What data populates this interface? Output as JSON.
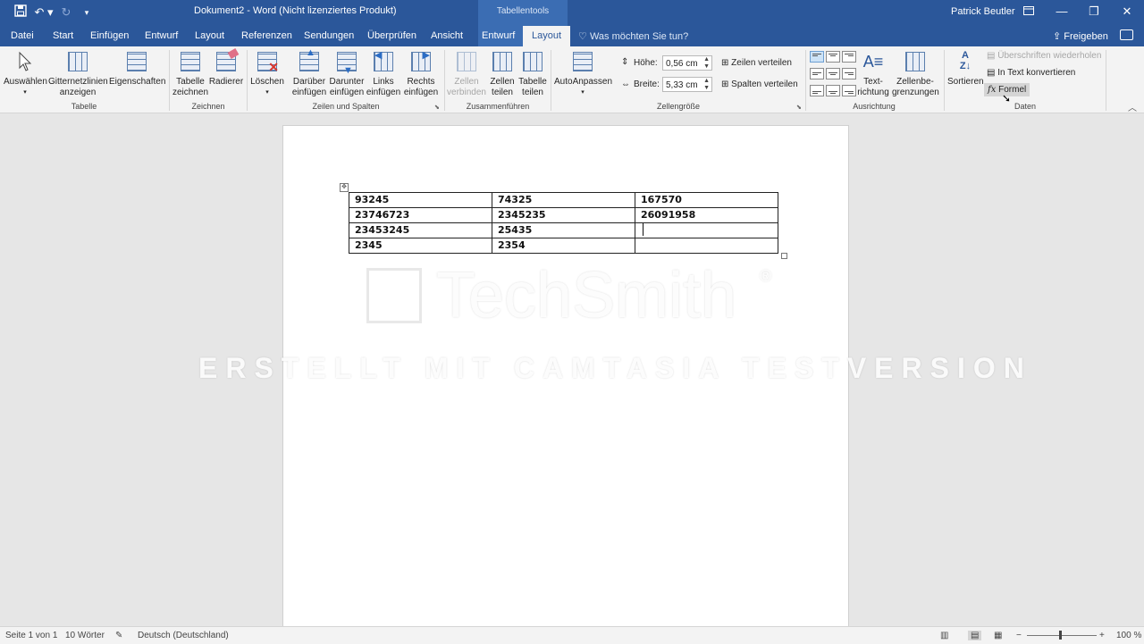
{
  "titlebar": {
    "title": "Dokument2 - Word (Nicht lizenziertes Produkt)",
    "context_tools": "Tabellentools",
    "user": "Patrick Beutler",
    "save_icon": "save-icon",
    "undo_icon": "undo-icon",
    "redo_icon": "redo-icon",
    "customize_icon": "customize-quick-access-icon"
  },
  "tabs": {
    "file": "Datei",
    "home": "Start",
    "insert": "Einfügen",
    "design": "Entwurf",
    "layout": "Layout",
    "references": "Referenzen",
    "mailings": "Sendungen",
    "review": "Überprüfen",
    "view": "Ansicht",
    "table_design": "Entwurf",
    "table_layout": "Layout",
    "tell_me": "Was möchten Sie tun?",
    "share": "Freigeben"
  },
  "ribbon": {
    "tabelle": {
      "label": "Tabelle",
      "select": "Auswählen",
      "gridlines_1": "Gitternetzlinien",
      "gridlines_2": "anzeigen",
      "properties": "Eigenschaften"
    },
    "zeichnen": {
      "label": "Zeichnen",
      "draw_1": "Tabelle",
      "draw_2": "zeichnen",
      "eraser": "Radierer"
    },
    "zeilen_spalten": {
      "label": "Zeilen und Spalten",
      "delete": "Löschen",
      "above_1": "Darüber",
      "above_2": "einfügen",
      "below_1": "Darunter",
      "below_2": "einfügen",
      "left_1": "Links",
      "left_2": "einfügen",
      "right_1": "Rechts",
      "right_2": "einfügen"
    },
    "zusammenfuehren": {
      "label": "Zusammenführen",
      "merge_1": "Zellen",
      "merge_2": "verbinden",
      "split_1": "Zellen",
      "split_2": "teilen",
      "splittable_1": "Tabelle",
      "splittable_2": "teilen"
    },
    "autofit": {
      "label": "AutoAnpassen"
    },
    "zellengroesse": {
      "label": "Zellengröße",
      "height_label": "Höhe:",
      "height_value": "0,56 cm",
      "width_label": "Breite:",
      "width_value": "5,33 cm",
      "distribute_rows": "Zeilen verteilen",
      "distribute_cols": "Spalten verteilen"
    },
    "ausrichtung": {
      "label": "Ausrichtung",
      "textdir_1": "Text-",
      "textdir_2": "richtung",
      "margins_1": "Zellenbe-",
      "margins_2": "grenzungen"
    },
    "daten": {
      "label": "Daten",
      "sort": "Sortieren",
      "repeat_header": "Überschriften wiederholen",
      "to_text": "In Text konvertieren",
      "formula": "Formel"
    }
  },
  "document": {
    "rows": [
      [
        "93245",
        "74325",
        "167570"
      ],
      [
        "23746723",
        "2345235",
        "26091958"
      ],
      [
        "23453245",
        "25435",
        ""
      ],
      [
        "2345",
        "2354",
        ""
      ]
    ]
  },
  "watermark": {
    "brand": "TechSmith",
    "registered": "®",
    "caption": "ERSTELLT MIT CAMTASIA TESTVERSION"
  },
  "statusbar": {
    "page": "Seite 1 von 1",
    "words": "10 Wörter",
    "language": "Deutsch (Deutschland)",
    "zoom": "100 %"
  }
}
